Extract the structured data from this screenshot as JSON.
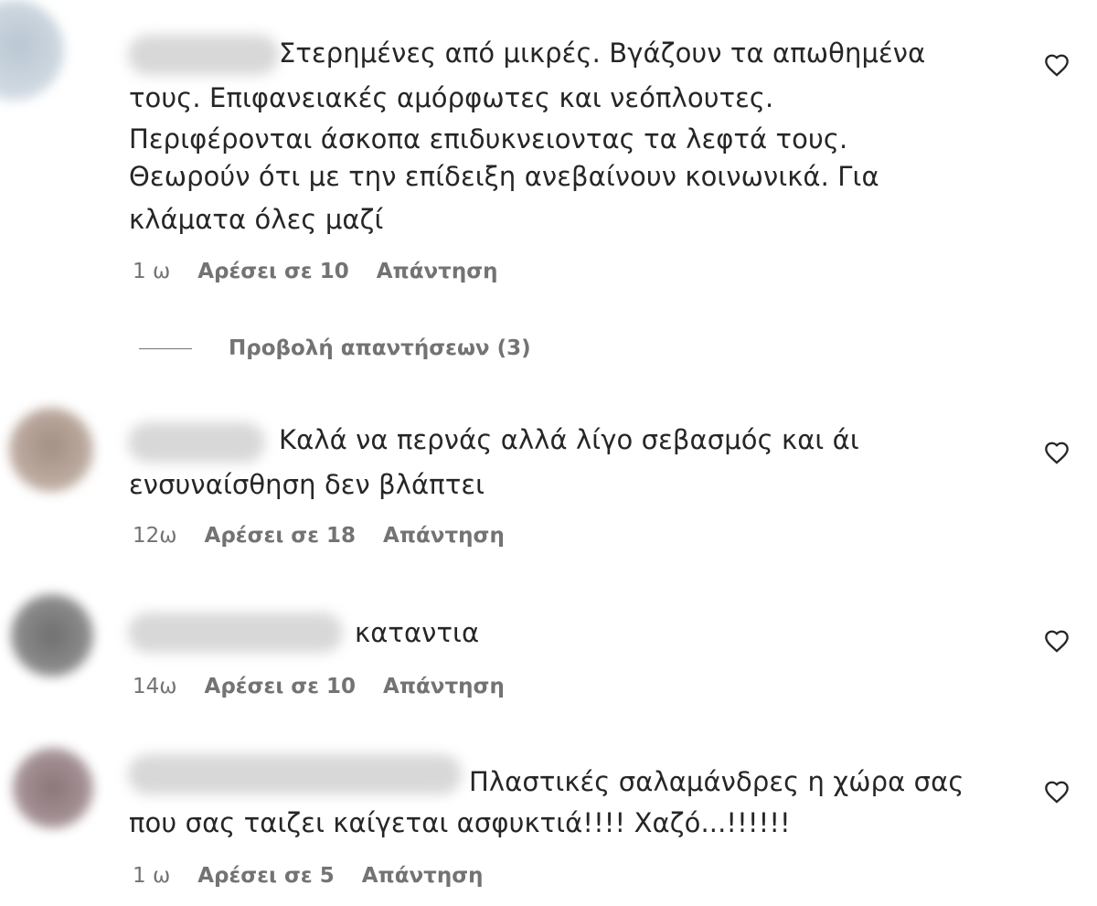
{
  "comments": [
    {
      "lines": [
        "Στερημένες από μικρές. Βγάζουν τα απωθημένα",
        "τους. Επιφανειακές αμόρφωτες και νεόπλουτες.",
        "Περιφέρονται άσκοπα επιδυκνειοντας τα λεφτά τους.",
        "Θεωρούν ότι με την επίδειξη ανεβαίνουν κοινωνικά. Για",
        "κλάματα όλες μαζί"
      ],
      "time": "1 ω",
      "likes": "Αρέσει σε 10",
      "reply": "Απάντηση"
    },
    {
      "lines": [
        "Καλά να περνάς αλλά λίγο σεβασμός και άι",
        "ενσυναίσθηση δεν βλάπτει"
      ],
      "time": "12ω",
      "likes": "Αρέσει σε 18",
      "reply": "Απάντηση"
    },
    {
      "lines": [
        "καταντια"
      ],
      "time": "14ω",
      "likes": "Αρέσει σε 10",
      "reply": "Απάντηση"
    },
    {
      "lines": [
        "Πλαστικές σαλαμάνδρες η χώρα σας",
        "που σας ταιζει καίγεται ασφυκτιά!!!! Χαζό...!!!!!!"
      ],
      "time": "1 ω",
      "likes": "Αρέσει σε 5",
      "reply": "Απάντηση"
    }
  ],
  "view_replies": "Προβολή απαντήσεων (3)",
  "icons": {
    "like": "heart-outline-icon"
  },
  "colors": {
    "text": "#262626",
    "meta": "#737373"
  }
}
